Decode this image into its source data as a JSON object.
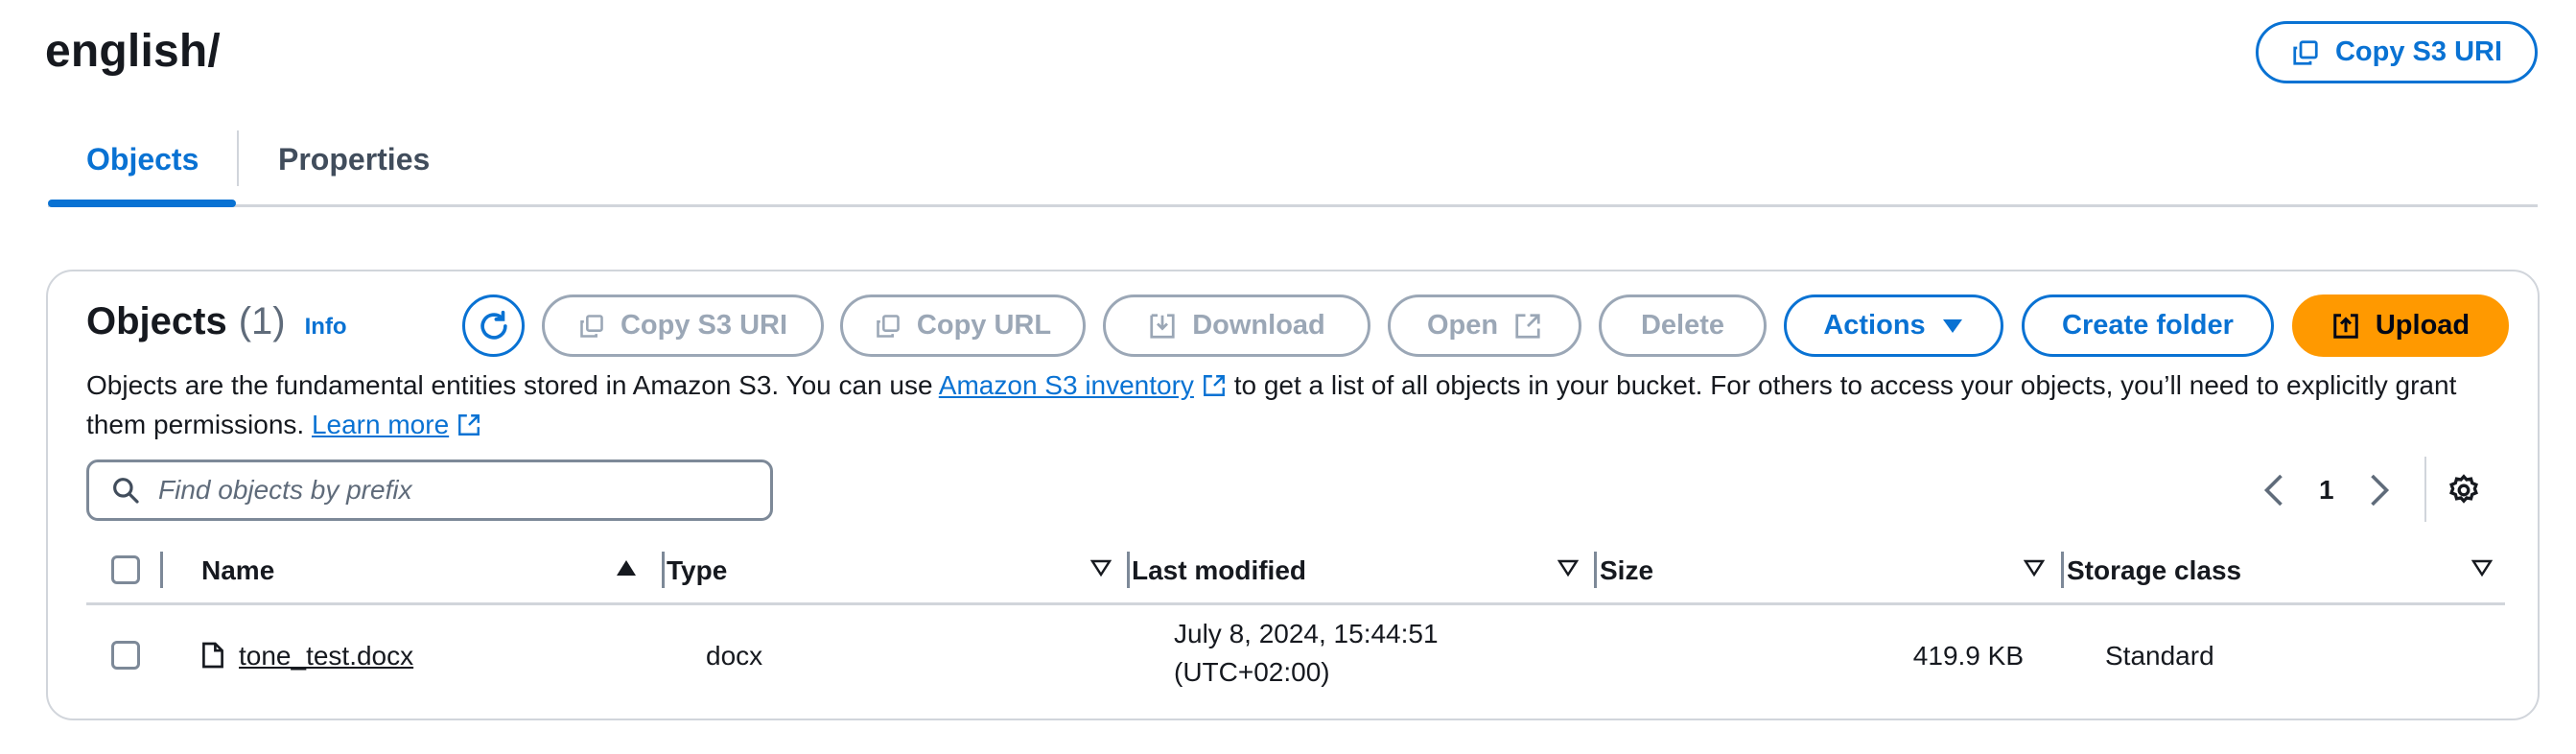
{
  "header": {
    "title": "english/",
    "copy_s3_uri_label": "Copy S3 URI"
  },
  "tabs": [
    {
      "label": "Objects",
      "active": true
    },
    {
      "label": "Properties",
      "active": false
    }
  ],
  "objects_panel": {
    "title": "Objects",
    "count": "(1)",
    "info_label": "Info",
    "toolbar": {
      "copy_s3_uri": "Copy S3 URI",
      "copy_url": "Copy URL",
      "download": "Download",
      "open": "Open",
      "delete": "Delete",
      "actions": "Actions",
      "create_folder": "Create folder",
      "upload": "Upload"
    },
    "description": {
      "part1": "Objects are the fundamental entities stored in Amazon S3. You can use ",
      "link1": "Amazon S3 inventory",
      "part2": " to get a list of all objects in your bucket. For others to access your objects, you’ll need to explicitly grant them permissions. ",
      "link2": "Learn more"
    },
    "search": {
      "placeholder": "Find objects by prefix",
      "value": ""
    },
    "pagination": {
      "current_page": "1"
    },
    "table": {
      "columns": [
        "Name",
        "Type",
        "Last modified",
        "Size",
        "Storage class"
      ],
      "rows": [
        {
          "name": "tone_test.docx",
          "type": "docx",
          "last_modified_line1": "July 8, 2024, 15:44:51",
          "last_modified_line2": "(UTC+02:00)",
          "size": "419.9 KB",
          "storage_class": "Standard"
        }
      ]
    }
  },
  "colors": {
    "accent": "#0972d3",
    "disabled": "#9ba7b6",
    "upload_bg": "#ff9900",
    "text": "#16191f",
    "border": "#d1d5db"
  },
  "icons": [
    "copy-icon",
    "refresh-icon",
    "download-icon",
    "external-link-icon",
    "caret-down-icon",
    "upload-icon",
    "search-icon",
    "chevron-left-icon",
    "chevron-right-icon",
    "settings-icon",
    "sort-ascending-icon",
    "sort-descending-outline-icon",
    "file-icon"
  ]
}
